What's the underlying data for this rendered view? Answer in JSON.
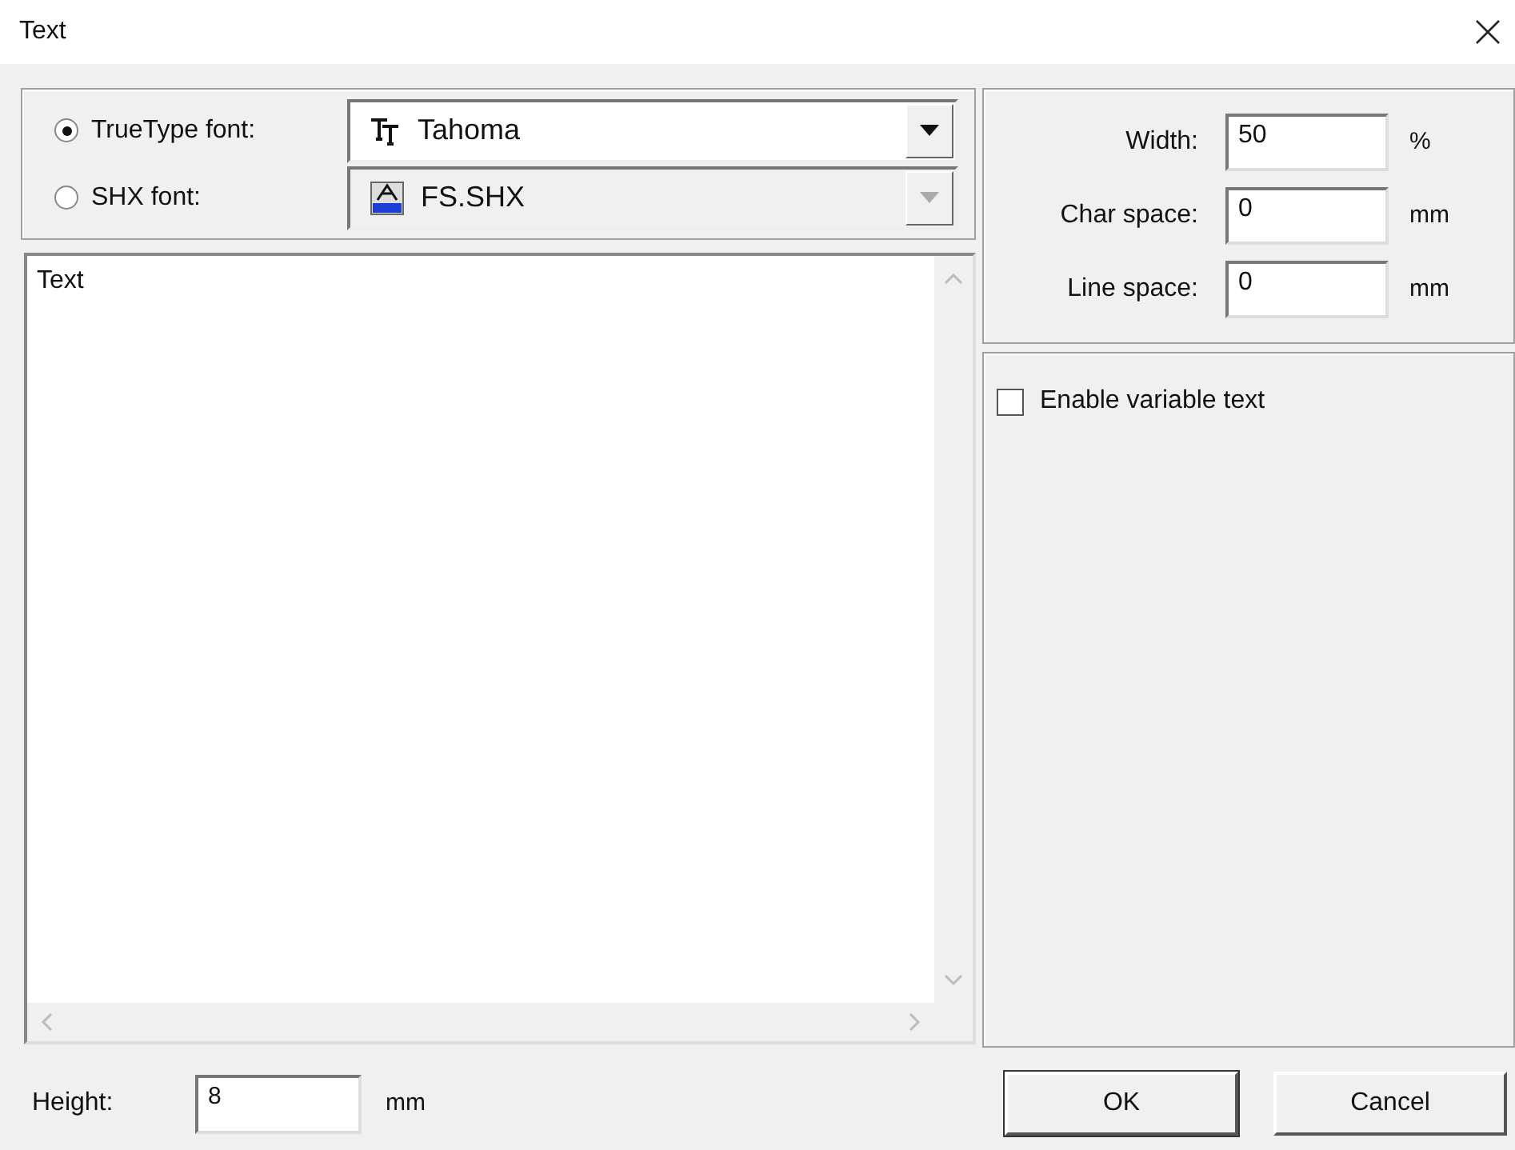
{
  "window": {
    "title": "Text"
  },
  "font_options": [
    {
      "label": "TrueType font:",
      "selected": true,
      "kind": "truetype",
      "value": "Tahoma",
      "disabled": false
    },
    {
      "label": "SHX font:",
      "selected": false,
      "kind": "shx",
      "value": "FS.SHX",
      "disabled": true
    }
  ],
  "text_area": {
    "value": "Text"
  },
  "metrics": [
    {
      "label": "Width:",
      "value": "50",
      "unit": "%"
    },
    {
      "label": "Char space:",
      "value": "0",
      "unit": "mm"
    },
    {
      "label": "Line space:",
      "value": "0",
      "unit": "mm"
    }
  ],
  "variable_text": {
    "label": "Enable variable text",
    "checked": false
  },
  "height": {
    "label": "Height:",
    "value": "8",
    "unit": "mm"
  },
  "buttons": [
    "OK",
    "Cancel"
  ]
}
